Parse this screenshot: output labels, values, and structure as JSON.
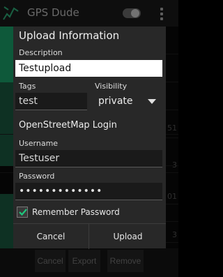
{
  "app": {
    "title": "GPS Dude",
    "icon": "gps-track-icon",
    "toggle_on": false
  },
  "background_list": {
    "row_numbers": [
      "",
      "",
      "",
      "",
      "51",
      "",
      "3",
      "01",
      "3",
      "",
      ""
    ]
  },
  "bottom_buttons": {
    "cancel_label": "Cancel",
    "export_label": "Export",
    "remove_label": "Remove"
  },
  "dialog": {
    "title": "Upload Information",
    "description_label": "Description",
    "description_value": "Testupload",
    "tags_label": "Tags",
    "tags_value": "test",
    "visibility_label": "Visibility",
    "visibility_value": "private",
    "login_section": "OpenStreetMap Login",
    "username_label": "Username",
    "username_value": "Testuser",
    "password_label": "Password",
    "password_value": "•••••••••••••",
    "remember_label": "Remember Password",
    "remember_checked": true,
    "cancel_label": "Cancel",
    "upload_label": "Upload"
  },
  "colors": {
    "accent": "#1aa36b",
    "dialog_bg": "#282828"
  }
}
